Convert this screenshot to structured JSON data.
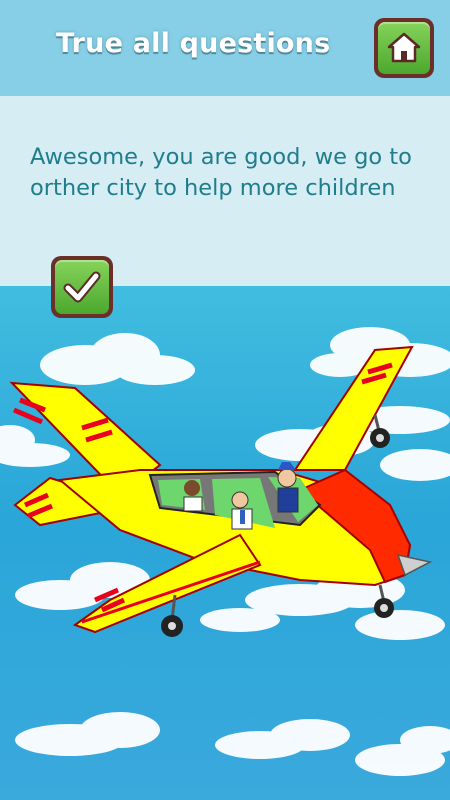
{
  "header": {
    "title": "True all questions",
    "home_button_icon": "home-icon"
  },
  "message": {
    "text": "Awesome, you are good, we go to orther city to help more children"
  },
  "confirm_button_icon": "checkmark-icon",
  "scene": {
    "illustration": "yellow-airplane-with-passengers",
    "colors": {
      "sky": "#2aa6d8",
      "plane_body": "#ffff00",
      "plane_nose": "#ff2a00",
      "button_green": "#5cb83a",
      "button_border": "#6b2f2a"
    }
  }
}
